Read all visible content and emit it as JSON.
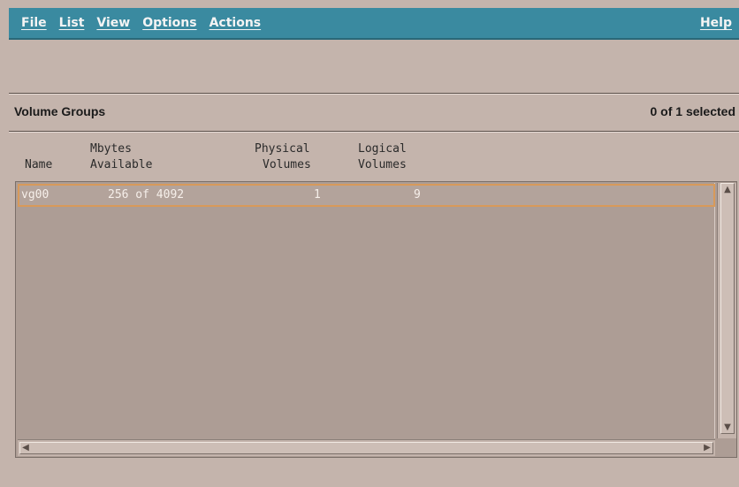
{
  "menubar": {
    "items": [
      "File",
      "List",
      "View",
      "Options",
      "Actions"
    ],
    "help": "Help"
  },
  "section": {
    "title": "Volume Groups",
    "selected": "0 of 1 selected"
  },
  "columns": {
    "name": "Name",
    "mbytes_line1": "Mbytes",
    "mbytes_line2": "Available",
    "physical_line1": "Physical",
    "physical_line2": "Volumes",
    "logical_line1": "Logical",
    "logical_line2": "Volumes"
  },
  "rows": [
    {
      "name": "vg00",
      "available": "256 of 4092",
      "physical_volumes": "1",
      "logical_volumes": "9"
    }
  ],
  "colors": {
    "menubar": "#3a8aa0",
    "background": "#c4b4ac",
    "list_background": "#ad9d95",
    "row_highlight_border": "#d89a5a"
  },
  "icons": {
    "scroll_up": "arrow-up-icon",
    "scroll_down": "arrow-down-icon",
    "scroll_left": "arrow-left-icon",
    "scroll_right": "arrow-right-icon"
  }
}
